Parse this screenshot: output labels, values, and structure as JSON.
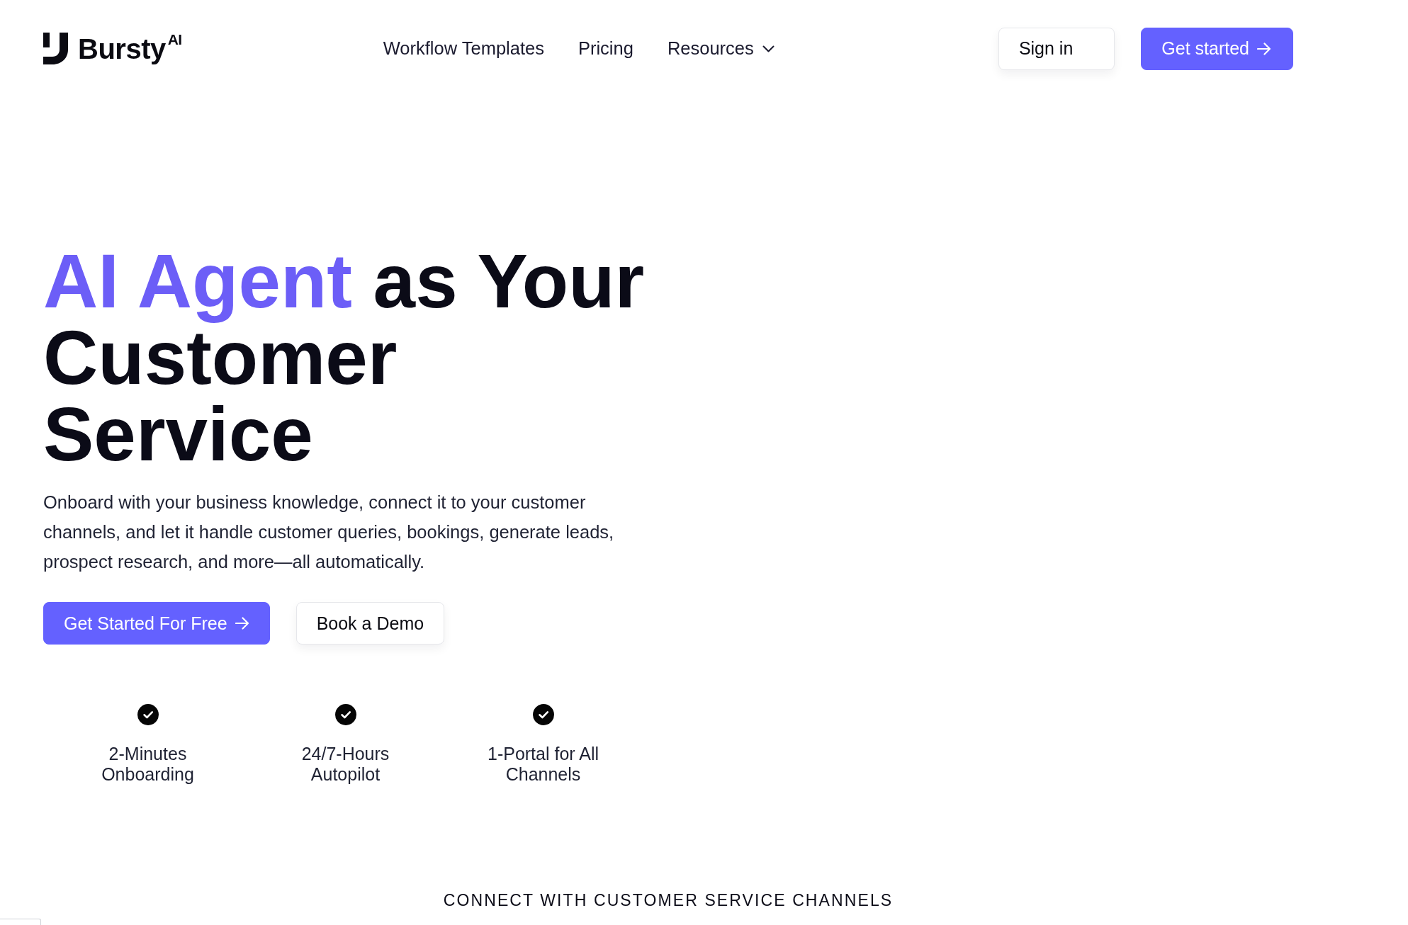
{
  "navbar": {
    "logo": "Bursty$^{AI}$",
    "links": [
      {
        "label": "Workflow Templates",
        "kind": "link"
      },
      {
        "label": "Pricing",
        "kind": "link"
      },
      {
        "label": "Resources",
        "kind": "dropdown"
      }
    ],
    "actions": [
      {
        "label": "Sign in",
        "kind": "secondary"
      },
      {
        "label": "Get started",
        "kind": "primary"
      }
    ]
  },
  "hero": {
    "title": {
      "highlight": "AI Agent",
      "rest": "as Your Customer Service"
    },
    "description": "Onboard with your business knowledge, connect it to your customer channels, and let it handle customer queries, bookings, generate leads, prospect research, and more—all automatically.",
    "buttons": [
      {
        "label": "Get Started For Free",
        "kind": "primary"
      },
      {
        "label": "Book a Demo",
        "kind": "secondary"
      }
    ],
    "features": [
      "2-Minutes Onboarding",
      "24/7-Hours Autopilot",
      "1-Portal for All Channels"
    ]
  },
  "channels_section": {
    "heading": "CONNECT WITH CUSTOMER SERVICE CHANNELS"
  }
}
